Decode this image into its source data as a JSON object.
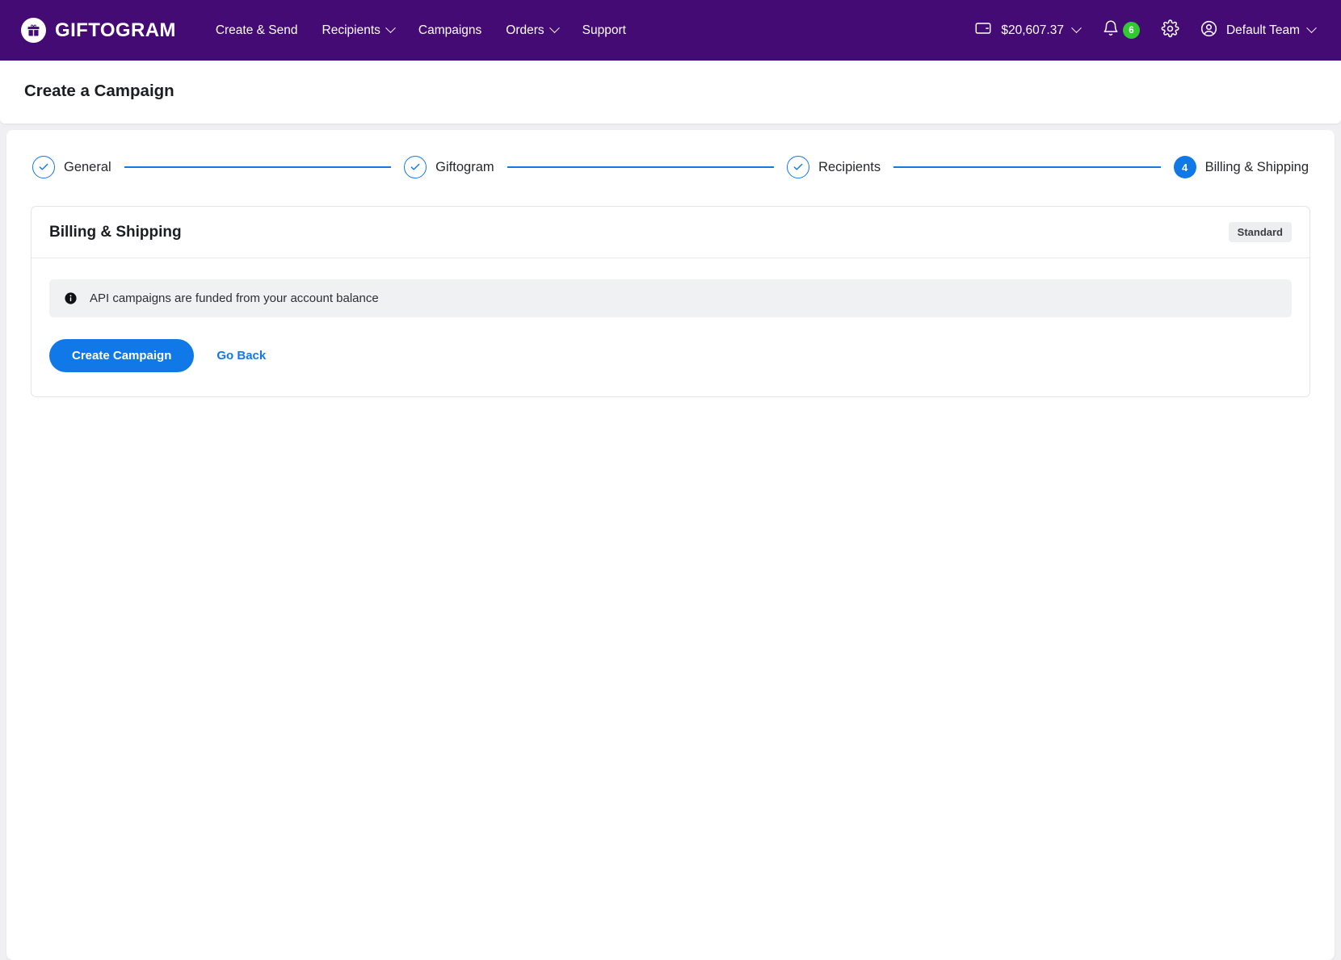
{
  "colors": {
    "nav_background": "#450b75",
    "accent_blue": "#1178e8",
    "badge_green": "#32c832",
    "page_background": "#f0f0f2",
    "banner_background": "#f0f1f3",
    "pill_background": "#edeef0"
  },
  "topnav": {
    "brand": {
      "name": "GIFTOGRAM",
      "logo_icon": "gift-box-icon"
    },
    "links": [
      {
        "label": "Create & Send",
        "has_caret": false
      },
      {
        "label": "Recipients",
        "has_caret": true
      },
      {
        "label": "Campaigns",
        "has_caret": false
      },
      {
        "label": "Orders",
        "has_caret": true
      },
      {
        "label": "Support",
        "has_caret": false
      }
    ],
    "balance": {
      "icon": "wallet-icon",
      "amount": "$20,607.37",
      "has_caret": true
    },
    "notifications": {
      "icon": "bell-icon",
      "count": "6"
    },
    "settings": {
      "icon": "gear-icon"
    },
    "account": {
      "icon": "user-circle-icon",
      "label": "Default Team",
      "has_caret": true
    }
  },
  "page": {
    "title": "Create a Campaign"
  },
  "stepper": {
    "steps": [
      {
        "number": "1",
        "label": "General",
        "state": "done",
        "mark": "✓"
      },
      {
        "number": "2",
        "label": "Giftogram",
        "state": "done",
        "mark": "✓"
      },
      {
        "number": "3",
        "label": "Recipients",
        "state": "done",
        "mark": "✓"
      },
      {
        "number": "4",
        "label": "Billing & Shipping",
        "state": "current",
        "mark": "4"
      }
    ]
  },
  "section": {
    "title": "Billing & Shipping",
    "badge": "Standard",
    "info_banner": {
      "icon": "info-filled-icon",
      "text": "API campaigns are funded from your account balance"
    },
    "actions": {
      "primary_label": "Create Campaign",
      "secondary_label": "Go Back"
    }
  }
}
